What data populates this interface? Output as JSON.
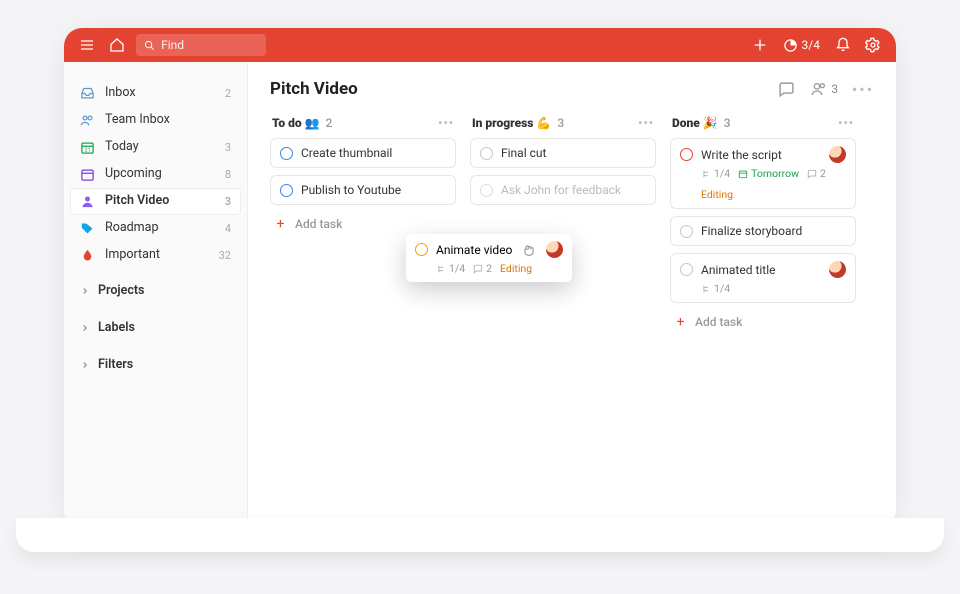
{
  "colors": {
    "accent": "#e44332"
  },
  "topbar": {
    "search_placeholder": "Find",
    "quota": "3/4"
  },
  "sidebar": {
    "items": [
      {
        "id": "inbox",
        "label": "Inbox",
        "count": "2",
        "icon": "inbox",
        "color": "#5b9bd5"
      },
      {
        "id": "team-inbox",
        "label": "Team Inbox",
        "count": "",
        "icon": "people",
        "color": "#5b9bd5"
      },
      {
        "id": "today",
        "label": "Today",
        "count": "3",
        "icon": "calendar-today",
        "color": "#16a34a"
      },
      {
        "id": "upcoming",
        "label": "Upcoming",
        "count": "8",
        "icon": "calendar",
        "color": "#7c3aed"
      },
      {
        "id": "pitch-video",
        "label": "Pitch Video",
        "count": "3",
        "icon": "user",
        "color": "#8b5cf6",
        "active": true
      },
      {
        "id": "roadmap",
        "label": "Roadmap",
        "count": "4",
        "icon": "tag",
        "color": "#0ea5e9"
      },
      {
        "id": "important",
        "label": "Important",
        "count": "32",
        "icon": "drop",
        "color": "#e44332"
      }
    ],
    "sections": [
      {
        "label": "Projects"
      },
      {
        "label": "Labels"
      },
      {
        "label": "Filters"
      }
    ]
  },
  "board": {
    "title": "Pitch Video",
    "share_count": "3",
    "columns": [
      {
        "title": "To do",
        "emoji": "👥",
        "count": "2",
        "tasks": [
          {
            "title": "Create thumbnail",
            "circle": "blue"
          },
          {
            "title": "Publish to Youtube",
            "circle": "blue"
          }
        ],
        "add_label": "Add task"
      },
      {
        "title": "In progress",
        "emoji": "💪",
        "count": "3",
        "tasks": [
          {
            "title": "Final cut",
            "circle": "muted"
          },
          {
            "title": "Ask John for feedback",
            "circle": "muted",
            "covered": true
          }
        ],
        "add_label": "Add task"
      },
      {
        "title": "Done",
        "emoji": "🎉",
        "count": "3",
        "tasks": [
          {
            "title": "Write the script",
            "circle": "red",
            "avatar": "red",
            "meta": {
              "sub": "1/4",
              "date": "Tomorrow",
              "comments": "2",
              "label": "Editing"
            }
          },
          {
            "title": "Finalize storyboard",
            "circle": "muted"
          },
          {
            "title": "Animated title",
            "circle": "muted",
            "avatar": "red",
            "meta": {
              "sub": "1/4"
            }
          }
        ],
        "add_label": "Add task"
      }
    ],
    "dragged": {
      "title": "Animate video",
      "circle": "orange",
      "avatar": "red",
      "meta": {
        "sub": "1/4",
        "comments": "2",
        "label": "Editing"
      }
    }
  }
}
